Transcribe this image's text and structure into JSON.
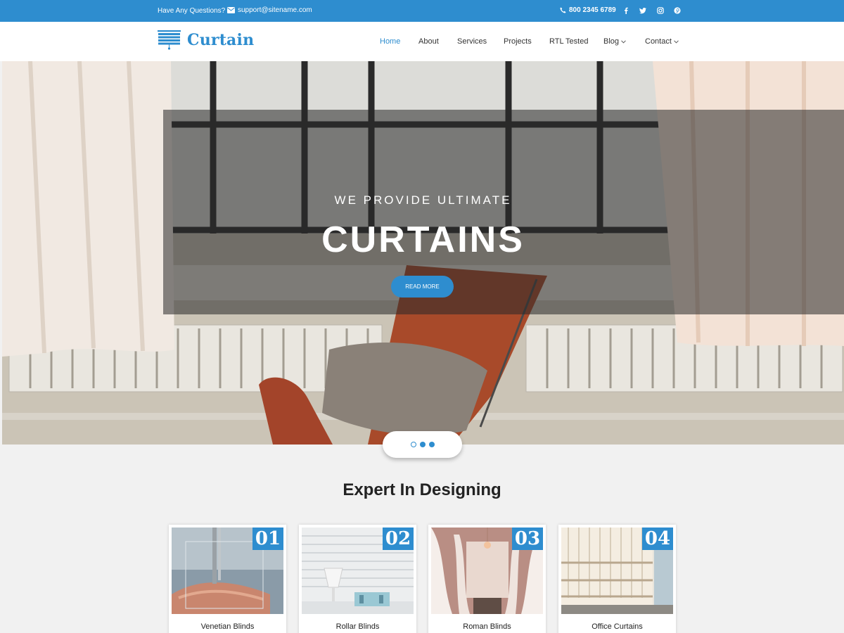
{
  "topbar": {
    "question": "Have Any Questions?",
    "email": "support@sitename.com",
    "phone": "800 2345 6789",
    "social_icons": [
      "facebook-icon",
      "twitter-icon",
      "instagram-icon",
      "pinterest-icon"
    ]
  },
  "header": {
    "brand": "Curtain",
    "nav": [
      {
        "label": "Home",
        "active": true
      },
      {
        "label": "About"
      },
      {
        "label": "Services"
      },
      {
        "label": "Projects"
      },
      {
        "label": "RTL Tested"
      },
      {
        "label": "Blog",
        "dropdown": true
      },
      {
        "label": "Contact",
        "dropdown": true
      }
    ]
  },
  "hero": {
    "subtitle": "WE PROVIDE ULTIMATE",
    "title": "CURTAINS",
    "button": "READ MORE",
    "slide_count": 3,
    "active_slide": 1
  },
  "section": {
    "title": "Expert In Designing",
    "cards": [
      {
        "number": "01",
        "label": "Venetian Blinds"
      },
      {
        "number": "02",
        "label": "Rollar Blinds"
      },
      {
        "number": "03",
        "label": "Roman Blinds"
      },
      {
        "number": "04",
        "label": "Office Curtains"
      }
    ]
  },
  "colors": {
    "accent": "#2e8dcf",
    "background": "#f1f1f1"
  }
}
